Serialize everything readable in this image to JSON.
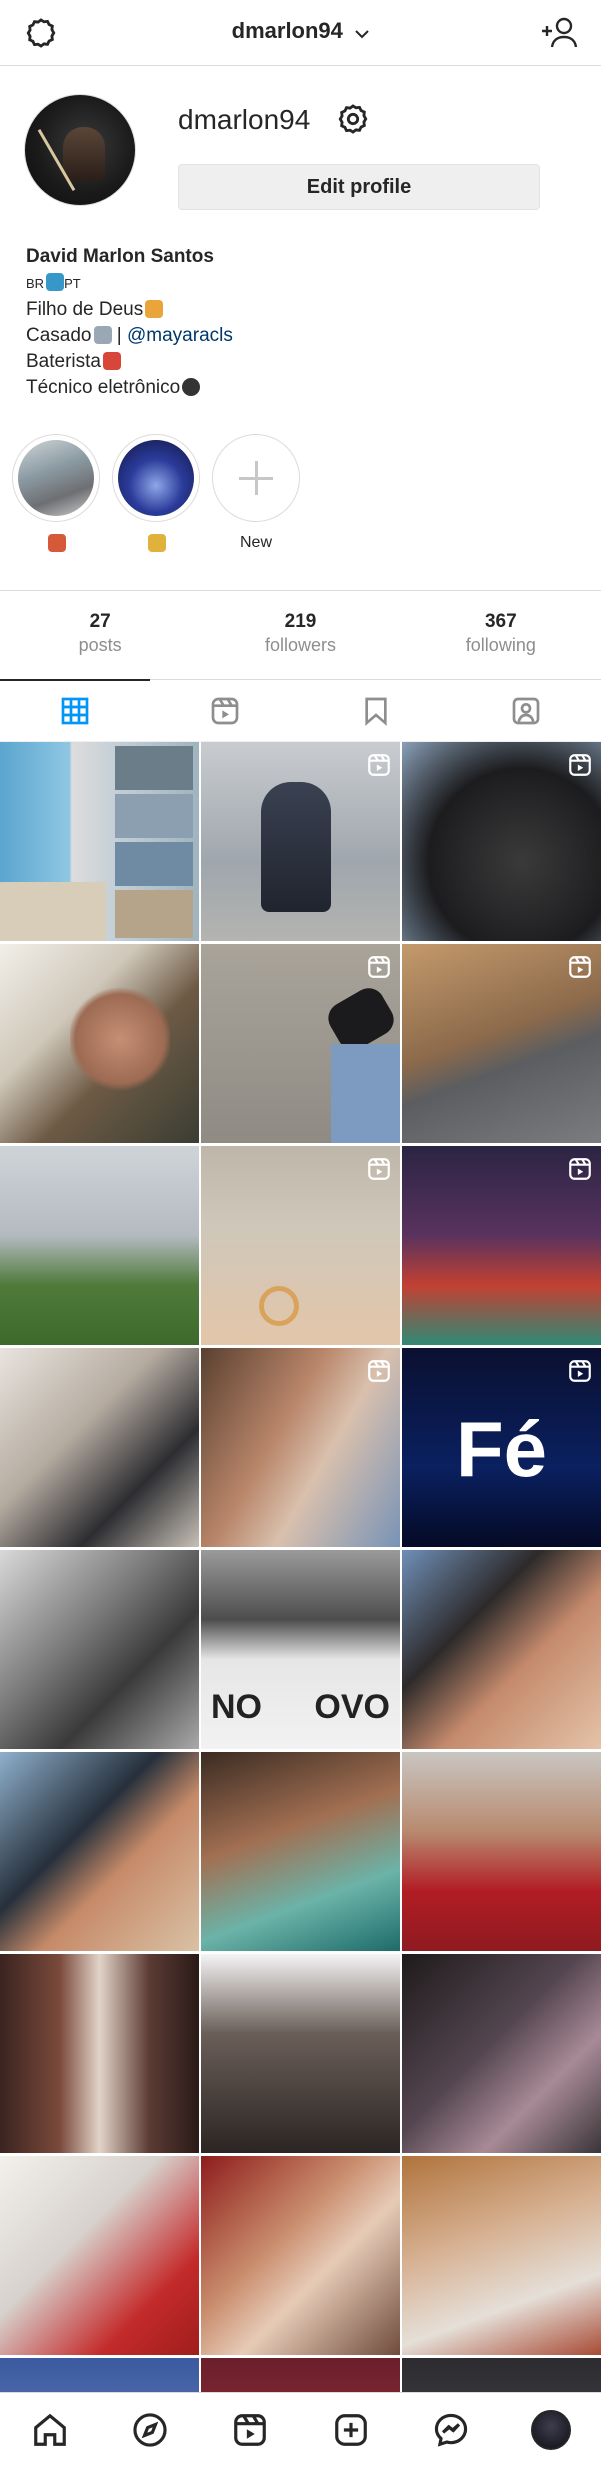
{
  "header": {
    "username": "dmarlon94",
    "settings_icon": "gear-icon",
    "switch_icon": "chevron-down-icon",
    "add_user_icon": "add-person-icon"
  },
  "profile": {
    "username": "dmarlon94",
    "edit_profile_label": "Edit profile",
    "bio": {
      "name": "David Marlon Santos",
      "line_flags_left": "BR",
      "line_flags_right": "PT",
      "line2": "Filho de Deus",
      "line3_prefix": "Casado",
      "line3_separator": " | ",
      "line3_mention": "@mayaracls",
      "line4": "Baterista",
      "line5": "Técnico eletrônico"
    }
  },
  "highlights": [
    {
      "label": "",
      "emoji_icon": "heart-emoji-icon"
    },
    {
      "label": "",
      "emoji_icon": "kiss-emoji-icon"
    },
    {
      "label": "New"
    }
  ],
  "stats": {
    "posts": {
      "value": "27",
      "label": "posts"
    },
    "followers": {
      "value": "219",
      "label": "followers"
    },
    "following": {
      "value": "367",
      "label": "following"
    }
  },
  "tabs": [
    {
      "name": "grid",
      "icon": "grid-icon",
      "active": true
    },
    {
      "name": "reels",
      "icon": "reels-icon",
      "active": false
    },
    {
      "name": "saved",
      "icon": "bookmark-icon",
      "active": false
    },
    {
      "name": "tagged",
      "icon": "tagged-icon",
      "active": false
    }
  ],
  "posts_text": {
    "fe": "Fé",
    "ano": "NO",
    "ovo": "OVO"
  },
  "bottom_nav": [
    {
      "name": "home",
      "icon": "home-icon"
    },
    {
      "name": "explore",
      "icon": "compass-icon"
    },
    {
      "name": "reels",
      "icon": "reels-icon"
    },
    {
      "name": "new-post",
      "icon": "plus-square-icon"
    },
    {
      "name": "messages",
      "icon": "messenger-icon"
    },
    {
      "name": "profile",
      "icon": "avatar"
    }
  ],
  "colors": {
    "text": "#262626",
    "muted": "#8e8e8e",
    "link": "#00376b",
    "border": "#dbdbdb",
    "button": "#efefef"
  }
}
